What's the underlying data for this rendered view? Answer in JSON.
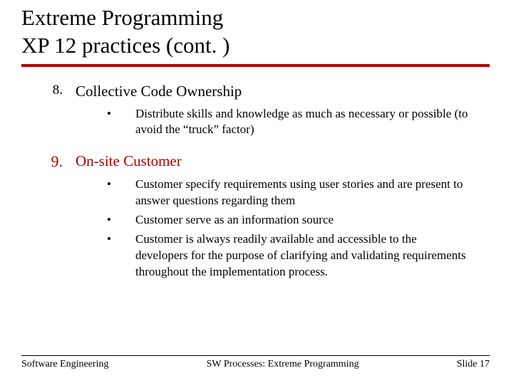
{
  "title_line1": "Extreme Programming",
  "title_line2": "XP 12 practices (cont. )",
  "items": [
    {
      "num": "8.",
      "heading": "Collective Code Ownership",
      "red": false,
      "sub": [
        "Distribute skills and knowledge as much as necessary or possible (to avoid the “truck” factor)"
      ]
    },
    {
      "num": "9.",
      "heading": "On-site Customer",
      "red": true,
      "sub": [
        "Customer specify requirements using user stories and are present to answer questions regarding them",
        " Customer serve as an information source",
        "Customer is always readily available and accessible to the developers for the purpose of clarifying and validating requirements throughout the implementation process."
      ]
    }
  ],
  "footer": {
    "left": "Software Engineering",
    "center": "SW Processes: Extreme Programming",
    "right": "Slide 17"
  }
}
